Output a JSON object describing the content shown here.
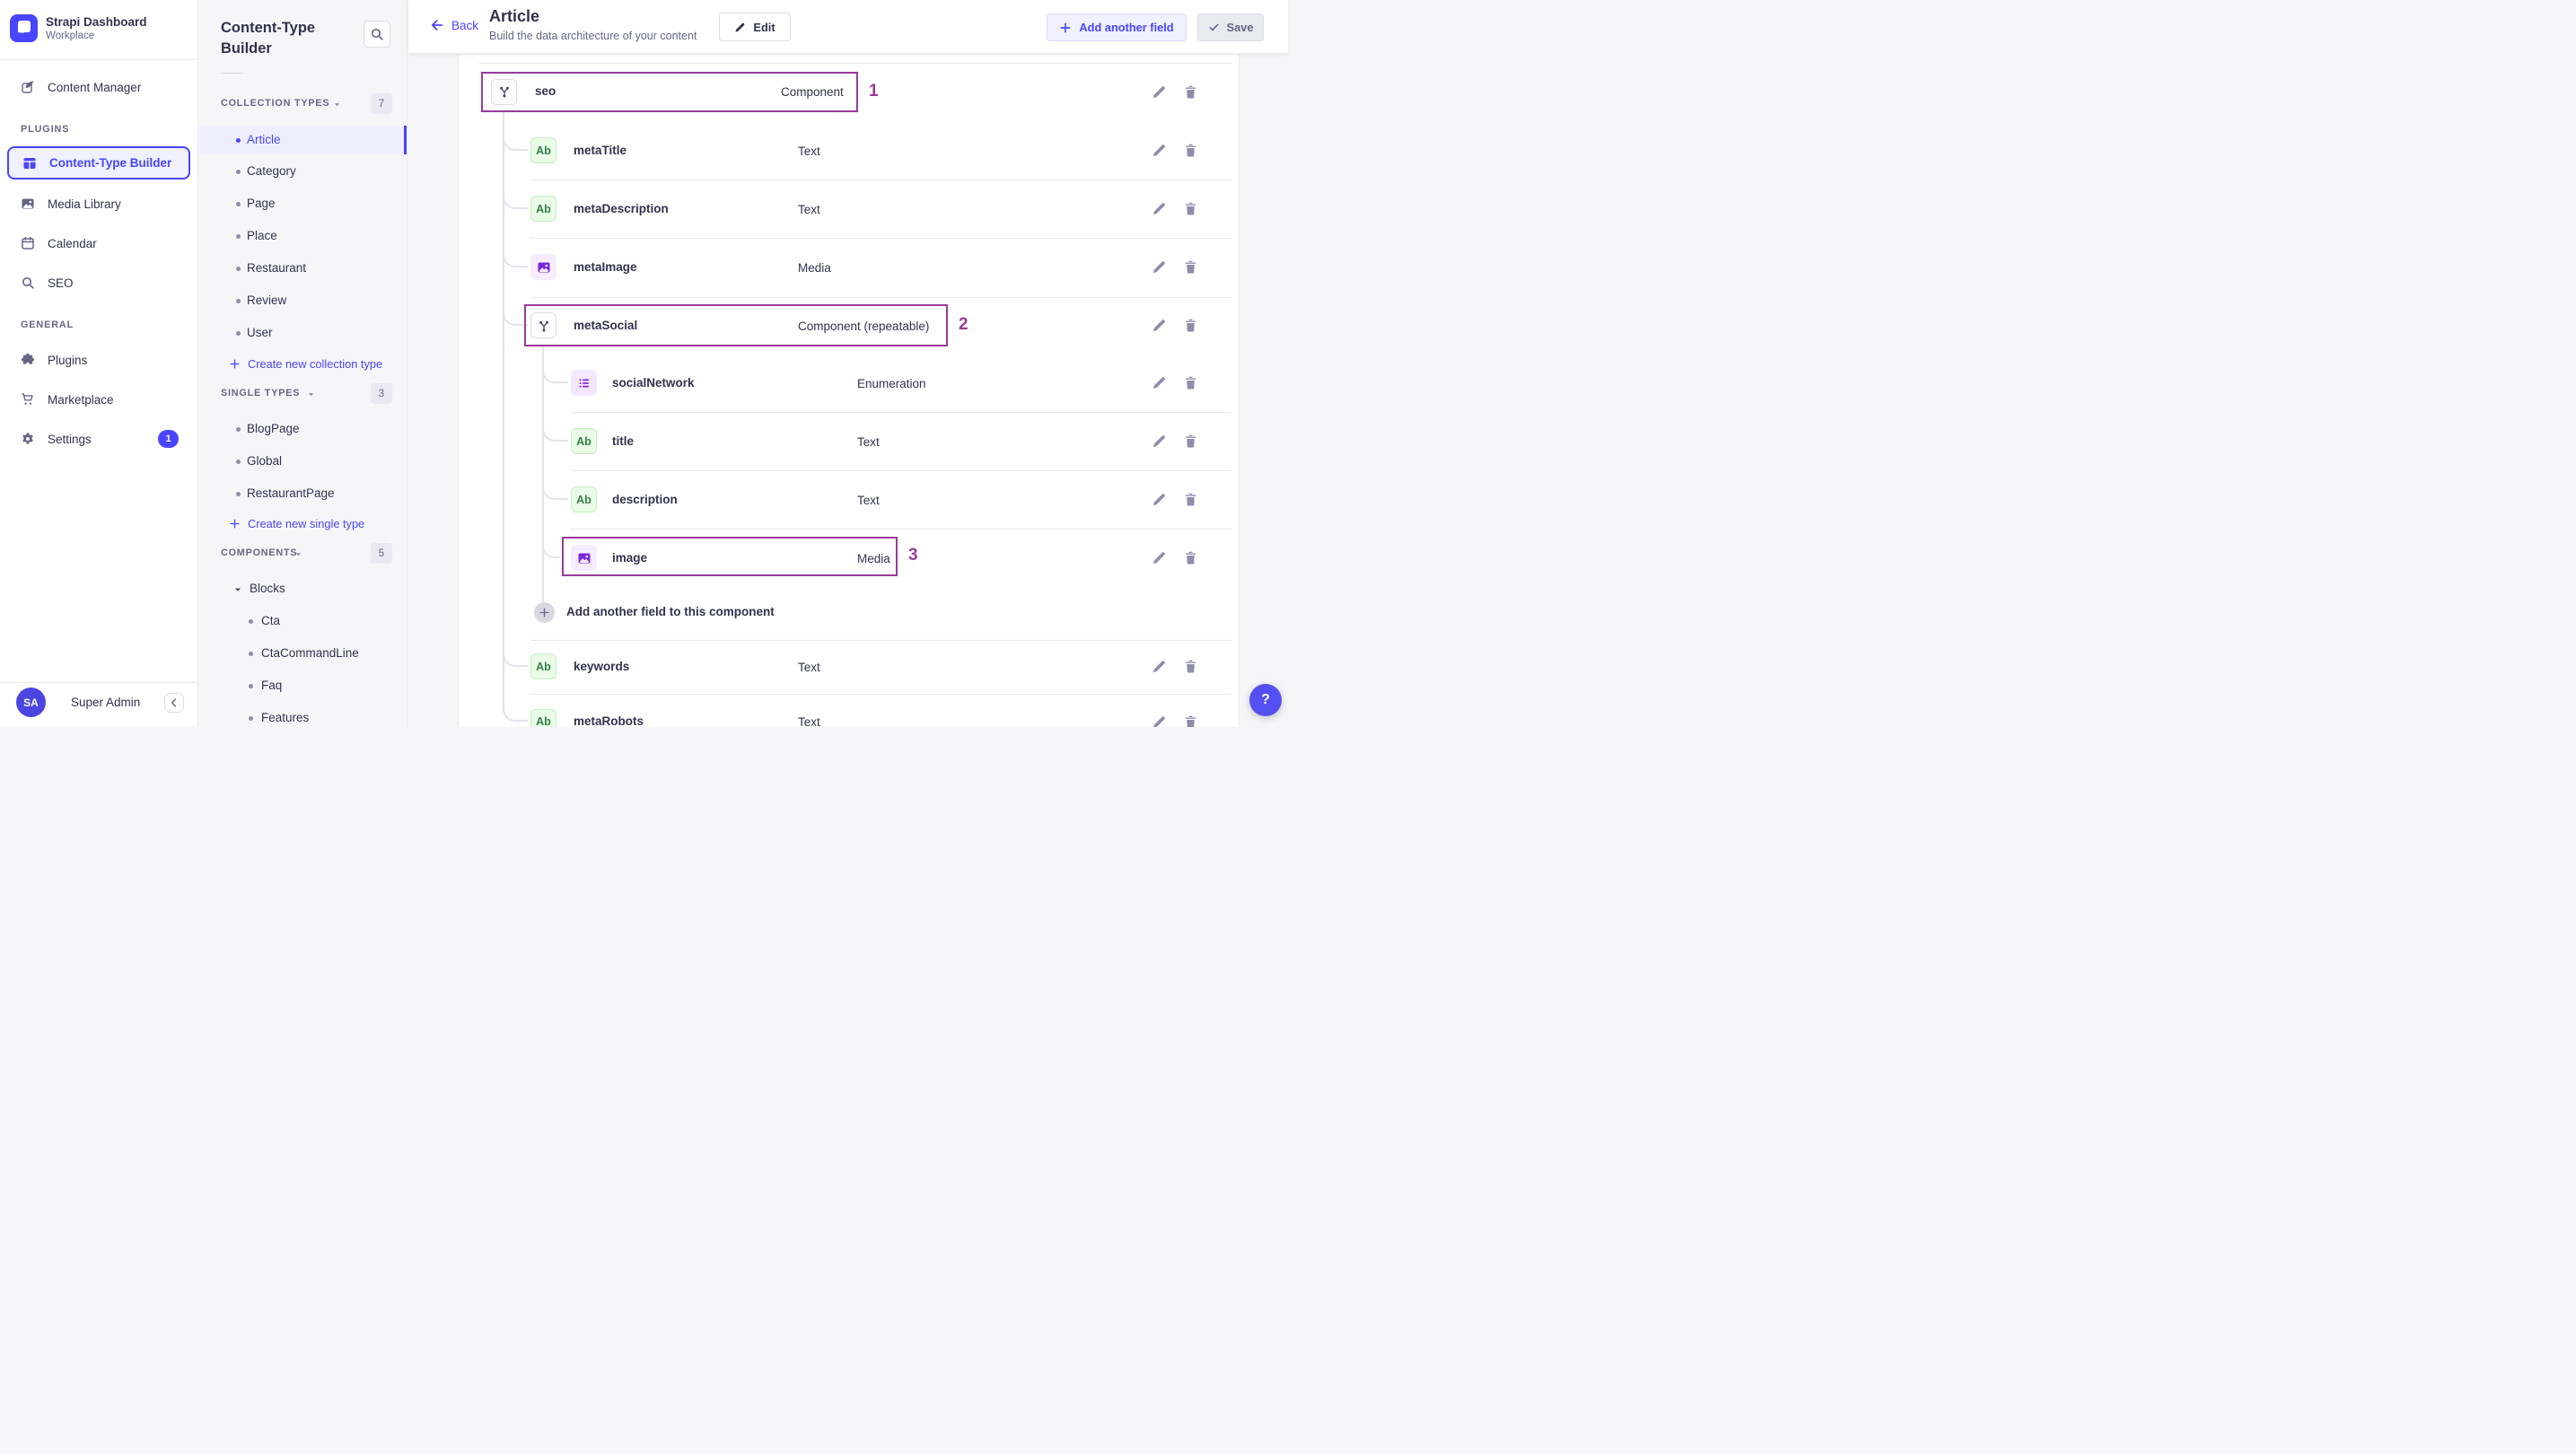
{
  "brand": {
    "title": "Strapi Dashboard",
    "subtitle": "Workplace"
  },
  "user": {
    "initials": "SA",
    "name": "Super Admin"
  },
  "sidebar": {
    "content_manager": {
      "label": "Content Manager",
      "icon": "content-manager-icon"
    },
    "sections": [
      {
        "label": "PLUGINS",
        "items": [
          {
            "label": "Content-Type Builder",
            "icon": "layout-icon",
            "active": true
          },
          {
            "label": "Media Library",
            "icon": "media-library-icon"
          },
          {
            "label": "Calendar",
            "icon": "calendar-icon"
          },
          {
            "label": "SEO",
            "icon": "search-icon"
          }
        ]
      },
      {
        "label": "GENERAL",
        "items": [
          {
            "label": "Plugins",
            "icon": "puzzle-icon"
          },
          {
            "label": "Marketplace",
            "icon": "cart-icon"
          },
          {
            "label": "Settings",
            "icon": "gear-icon",
            "badge": "1"
          }
        ]
      }
    ]
  },
  "subnav": {
    "title": "Content-Type Builder",
    "sections": [
      {
        "label": "COLLECTION TYPES",
        "count": "7",
        "items": [
          {
            "label": "Article",
            "active": true
          },
          {
            "label": "Category"
          },
          {
            "label": "Page"
          },
          {
            "label": "Place"
          },
          {
            "label": "Restaurant"
          },
          {
            "label": "Review"
          },
          {
            "label": "User"
          }
        ],
        "action": "Create new collection type"
      },
      {
        "label": "SINGLE TYPES",
        "count": "3",
        "items": [
          {
            "label": "BlogPage"
          },
          {
            "label": "Global"
          },
          {
            "label": "RestaurantPage"
          }
        ],
        "action": "Create new single type"
      },
      {
        "label": "COMPONENTS",
        "count": "5",
        "groups": [
          {
            "label": "Blocks",
            "items": [
              {
                "label": "Cta"
              },
              {
                "label": "CtaCommandLine"
              },
              {
                "label": "Faq"
              },
              {
                "label": "Features"
              }
            ]
          }
        ]
      }
    ]
  },
  "header": {
    "back": "Back",
    "title": "Article",
    "subtitle": "Build the data architecture of your content",
    "edit": "Edit",
    "add_field": "Add another field",
    "save": "Save"
  },
  "content": {
    "fields": [
      {
        "name": "seo",
        "type": "Component",
        "kind": "component",
        "level": 0,
        "annotation": "1"
      },
      {
        "name": "metaTitle",
        "type": "Text",
        "kind": "text",
        "level": 1
      },
      {
        "name": "metaDescription",
        "type": "Text",
        "kind": "text",
        "level": 1
      },
      {
        "name": "metaImage",
        "type": "Media",
        "kind": "media",
        "level": 1
      },
      {
        "name": "metaSocial",
        "type": "Component (repeatable)",
        "kind": "component",
        "level": 1,
        "annotation": "2"
      },
      {
        "name": "socialNetwork",
        "type": "Enumeration",
        "kind": "enumeration",
        "level": 2
      },
      {
        "name": "title",
        "type": "Text",
        "kind": "text",
        "level": 2
      },
      {
        "name": "description",
        "type": "Text",
        "kind": "text",
        "level": 2
      },
      {
        "name": "image",
        "type": "Media",
        "kind": "media",
        "level": 2,
        "annotation": "3"
      },
      {
        "name": "keywords",
        "type": "Text",
        "kind": "text",
        "level": 1
      },
      {
        "name": "metaRobots",
        "type": "Text",
        "kind": "text",
        "level": 1
      }
    ],
    "text_field_badge": "Ab",
    "add_component_field": "Add another field to this component"
  },
  "help": {
    "label": "?"
  },
  "colors": {
    "accent": "#4945ff",
    "annotation": "#9b3a9b",
    "active_bg": "#f0f0ff",
    "success_text": "#328048",
    "purple_icon": "#7a28d8"
  }
}
